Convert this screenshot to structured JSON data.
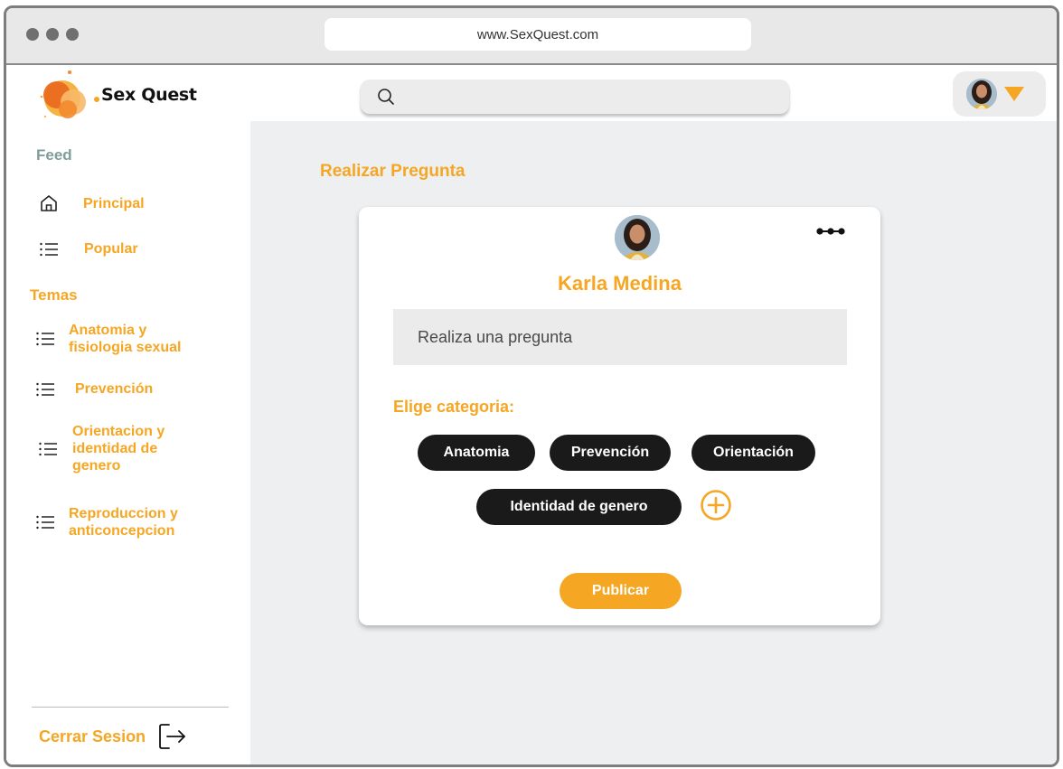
{
  "browser": {
    "url": "www.SexQuest.com"
  },
  "header": {
    "brand": "Sex Quest",
    "search_placeholder": ""
  },
  "sidebar": {
    "feed_heading": "Feed",
    "feed_items": [
      {
        "label": "Principal",
        "icon": "home-icon"
      },
      {
        "label": "Popular",
        "icon": "list-icon"
      }
    ],
    "topics_heading": "Temas",
    "topic_items": [
      {
        "label": "Anatomia y fisiologia sexual",
        "icon": "list-icon"
      },
      {
        "label": "Prevención",
        "icon": "list-icon"
      },
      {
        "label": "Orientacion y identidad de genero",
        "icon": "list-icon"
      },
      {
        "label": "Reproduccion y anticoncepcion",
        "icon": "list-icon"
      }
    ],
    "logout_label": "Cerrar Sesion"
  },
  "main": {
    "page_title": "Realizar Pregunta",
    "card": {
      "user_name": "Karla Medina",
      "question_placeholder": "Realiza una pregunta",
      "category_label": "Elige categoria:",
      "categories": [
        "Anatomia",
        "Prevención",
        "Orientación",
        "Identidad de genero"
      ],
      "publish_label": "Publicar"
    }
  },
  "colors": {
    "accent": "#f5a623",
    "feed_heading": "#7f9d9a",
    "chip_bg": "#1a1a1a",
    "main_bg": "#edeff1"
  }
}
